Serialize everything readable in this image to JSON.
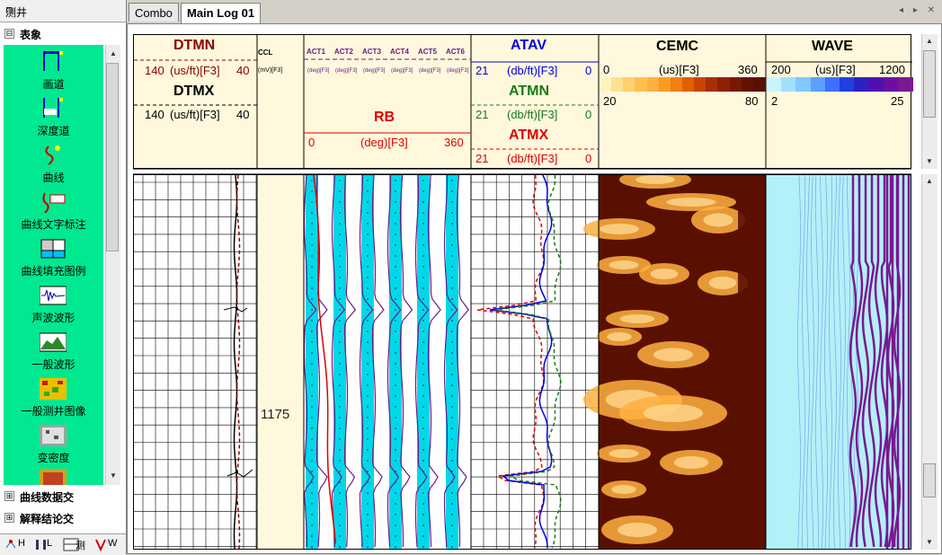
{
  "left_panel": {
    "title": "测井",
    "pin": "⊓",
    "groups": [
      {
        "label": "表象",
        "toggle": "⊟"
      },
      {
        "label": "曲线数据交",
        "toggle": "⊞"
      },
      {
        "label": "解释结论交",
        "toggle": "⊞"
      }
    ],
    "palette_items": [
      {
        "label": "画道",
        "icon": "track-icon"
      },
      {
        "label": "深度道",
        "icon": "depth-track-icon"
      },
      {
        "label": "曲线",
        "icon": "curve-icon"
      },
      {
        "label": "曲线文字标注",
        "icon": "curve-text-annotation-icon"
      },
      {
        "label": "曲线填充图例",
        "icon": "curve-fill-legend-icon"
      },
      {
        "label": "声波波形",
        "icon": "acoustic-waveform-icon"
      },
      {
        "label": "一般波形",
        "icon": "general-waveform-icon"
      },
      {
        "label": "一般测井图像",
        "icon": "log-image-icon"
      },
      {
        "label": "变密度",
        "icon": "variable-density-icon"
      }
    ],
    "bottom_tabs": [
      "H",
      "L",
      "测",
      "W"
    ]
  },
  "tabs": [
    {
      "label": "Combo",
      "active": false
    },
    {
      "label": "Main Log 01",
      "active": true
    }
  ],
  "nav": "◂ ▸ ✕",
  "header": {
    "dtmn": {
      "name": "DTMN",
      "min": "140",
      "unit": "(us/ft)[F3]",
      "max": "40",
      "color": "#8b0000"
    },
    "dtmx": {
      "name": "DTMX",
      "min": "140",
      "unit": "(us/ft)[F3]",
      "max": "40",
      "color": "#000000"
    },
    "ccl": {
      "name": "CCL",
      "unit": "(mV)[F3]"
    },
    "act_curves": [
      "ACT1",
      "ACT2",
      "ACT3",
      "ACT4",
      "ACT5",
      "ACT6"
    ],
    "act_unit": "(deg)[F3]",
    "rb": {
      "name": "RB",
      "min": "0",
      "unit": "(deg)[F3]",
      "max": "360",
      "color": "#e00000"
    },
    "atav": {
      "name": "ATAV",
      "min": "21",
      "unit": "(db/ft)[F3]",
      "max": "0",
      "color": "#0000e0"
    },
    "atmn": {
      "name": "ATMN",
      "min": "21",
      "unit": "(db/ft)[F3]",
      "max": "0",
      "color": "#1a7a1a"
    },
    "atmx": {
      "name": "ATMX",
      "min": "21",
      "unit": "(db/ft)[F3]",
      "max": "0",
      "color": "#e00000"
    },
    "cemc": {
      "name": "CEMC",
      "min": "0",
      "unit": "(us)[F3]",
      "max": "360",
      "scale_min": "20",
      "scale_max": "80"
    },
    "wave": {
      "name": "WAVE",
      "min": "200",
      "unit": "(us)[F3]",
      "max": "1200",
      "scale_min": "2",
      "scale_max": "25"
    }
  },
  "depth_label": "1175",
  "colors": {
    "header_bg": "#fff8dc",
    "palette_bg": "#00e890",
    "act_fill": "#00d8e8",
    "cemc_dark": "#5a1000",
    "cemc_light": "#ffb040",
    "wave_bg": "#b4f0f8",
    "wave_band": "#7a1890"
  }
}
